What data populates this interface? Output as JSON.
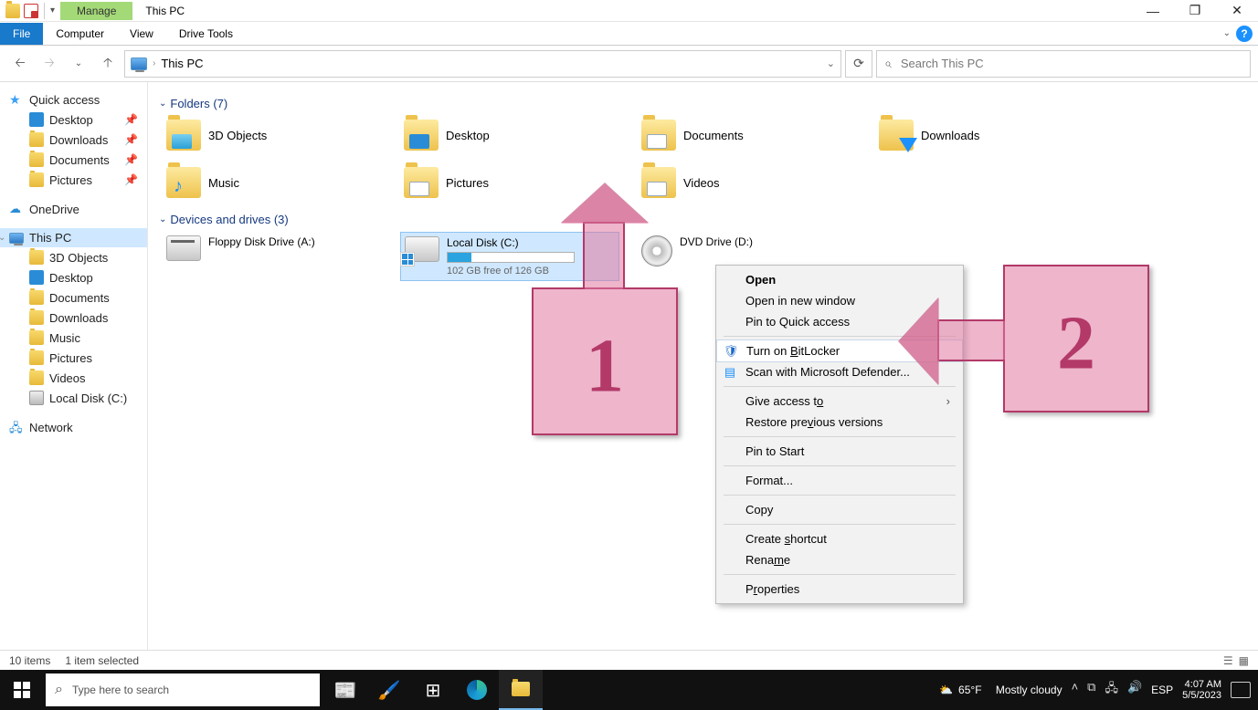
{
  "titlebar": {
    "manage_label": "Manage",
    "window_title": "This PC"
  },
  "ribbon": {
    "file": "File",
    "computer": "Computer",
    "view": "View",
    "drive_tools": "Drive Tools"
  },
  "nav": {
    "address_label": "This PC",
    "search_placeholder": "Search This PC"
  },
  "sidebar": {
    "quick_access": "Quick access",
    "qa_items": [
      {
        "label": "Desktop",
        "pinned": true,
        "icon": "blue-sq"
      },
      {
        "label": "Downloads",
        "pinned": true,
        "icon": "folder-sm"
      },
      {
        "label": "Documents",
        "pinned": true,
        "icon": "folder-sm"
      },
      {
        "label": "Pictures",
        "pinned": true,
        "icon": "folder-sm"
      }
    ],
    "onedrive": "OneDrive",
    "this_pc": "This PC",
    "pc_items": [
      {
        "label": "3D Objects",
        "icon": "folder-sm"
      },
      {
        "label": "Desktop",
        "icon": "blue-sq"
      },
      {
        "label": "Documents",
        "icon": "folder-sm"
      },
      {
        "label": "Downloads",
        "icon": "folder-sm"
      },
      {
        "label": "Music",
        "icon": "folder-sm"
      },
      {
        "label": "Pictures",
        "icon": "folder-sm"
      },
      {
        "label": "Videos",
        "icon": "folder-sm"
      },
      {
        "label": "Local Disk (C:)",
        "icon": "drive-sm"
      }
    ],
    "network": "Network"
  },
  "groups": {
    "folders_hdr": "Folders (7)",
    "drives_hdr": "Devices and drives (3)"
  },
  "folders": [
    {
      "label": "3D Objects",
      "accent": "acc-3d"
    },
    {
      "label": "Desktop",
      "accent": "acc-desk"
    },
    {
      "label": "Documents",
      "accent": "acc-doc"
    },
    {
      "label": "Downloads",
      "accent": "acc-down",
      "down_arrow": true
    },
    {
      "label": "Music",
      "accent": "acc-music",
      "music": true
    },
    {
      "label": "Pictures",
      "accent": "acc-pic"
    },
    {
      "label": "Videos",
      "accent": "acc-vid"
    }
  ],
  "drives": [
    {
      "label": "Floppy Disk Drive (A:)",
      "kind": "floppy"
    },
    {
      "label": "Local Disk (C:)",
      "kind": "hdd",
      "selected": true,
      "free_text": "102 GB free of 126 GB",
      "fill_pct": 19
    },
    {
      "label": "DVD Drive (D:)",
      "kind": "dvd"
    }
  ],
  "context_menu": {
    "items": [
      {
        "label": "Open",
        "bold": true
      },
      {
        "label": "Open in new window"
      },
      {
        "label": "Pin to Quick access"
      },
      {
        "sep": true
      },
      {
        "label": "Turn on BitLocker",
        "icon": "shield",
        "hov": true,
        "accel": "B"
      },
      {
        "label": "Scan with Microsoft Defender...",
        "icon": "def"
      },
      {
        "sep": true
      },
      {
        "label": "Give access to",
        "submenu": true,
        "accel": "o"
      },
      {
        "label": "Restore previous versions",
        "accel": "v"
      },
      {
        "sep": true
      },
      {
        "label": "Pin to Start"
      },
      {
        "sep": true
      },
      {
        "label": "Format..."
      },
      {
        "sep": true
      },
      {
        "label": "Copy"
      },
      {
        "sep": true
      },
      {
        "label": "Create shortcut",
        "accel": "s"
      },
      {
        "label": "Rename",
        "accel": "m"
      },
      {
        "sep": true
      },
      {
        "label": "Properties",
        "accel": "r"
      }
    ]
  },
  "callouts": {
    "one": "1",
    "two": "2"
  },
  "status": {
    "items": "10 items",
    "selected": "1 item selected"
  },
  "taskbar": {
    "search_placeholder": "Type here to search",
    "weather_temp": "65°F",
    "weather_desc": "Mostly cloudy",
    "lang": "ESP",
    "time": "4:07 AM",
    "date": "5/5/2023"
  }
}
